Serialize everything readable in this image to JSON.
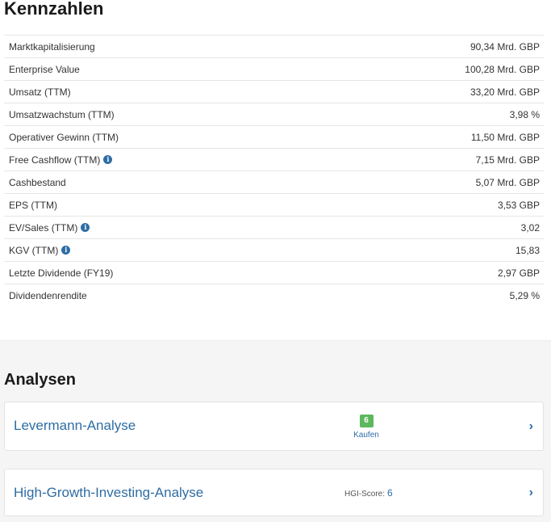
{
  "kennzahlen": {
    "title": "Kennzahlen",
    "rows": [
      {
        "label": "Marktkapitalisierung",
        "value": "90,34 Mrd. GBP",
        "info": false
      },
      {
        "label": "Enterprise Value",
        "value": "100,28 Mrd. GBP",
        "info": false
      },
      {
        "label": "Umsatz (TTM)",
        "value": "33,20 Mrd. GBP",
        "info": false
      },
      {
        "label": "Umsatzwachstum (TTM)",
        "value": "3,98 %",
        "info": false
      },
      {
        "label": "Operativer Gewinn (TTM)",
        "value": "11,50 Mrd. GBP",
        "info": false
      },
      {
        "label": "Free Cashflow (TTM)",
        "value": "7,15 Mrd. GBP",
        "info": true
      },
      {
        "label": "Cashbestand",
        "value": "5,07 Mrd. GBP",
        "info": false
      },
      {
        "label": "EPS (TTM)",
        "value": "3,53 GBP",
        "info": false
      },
      {
        "label": "EV/Sales (TTM)",
        "value": "3,02",
        "info": true
      },
      {
        "label": "KGV (TTM)",
        "value": "15,83",
        "info": true
      },
      {
        "label": "Letzte Dividende (FY19)",
        "value": "2,97 GBP",
        "info": false
      },
      {
        "label": "Dividendenrendite",
        "value": "5,29 %",
        "info": false
      }
    ],
    "info_icon_glyph": "i"
  },
  "analysen": {
    "title": "Analysen",
    "levermann": {
      "title": "Levermann-Analyse",
      "score": "6",
      "rating": "Kaufen",
      "badge_color": "#5cb85c"
    },
    "hgi": {
      "title": "High-Growth-Investing-Analyse",
      "score_label": "HGI-Score:",
      "score": "6"
    },
    "chevron_glyph": "›"
  },
  "colors": {
    "link": "#2e6da4",
    "section_bg": "#f5f5f5"
  }
}
